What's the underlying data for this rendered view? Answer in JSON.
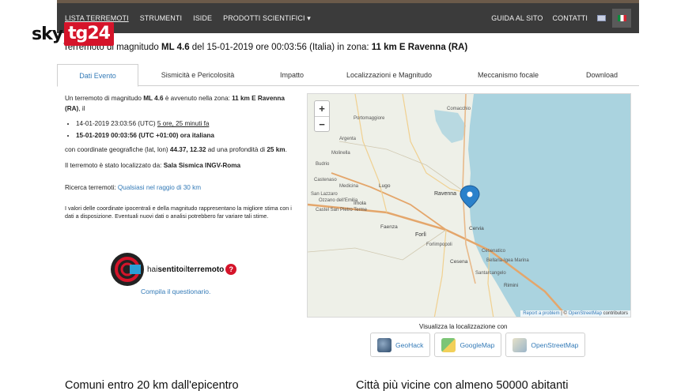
{
  "nav": {
    "items": [
      "LISTA TERREMOTI",
      "STRUMENTI",
      "ISIDE",
      "PRODOTTI SCIENTIFICI ▾"
    ],
    "right": [
      "GUIDA AL SITO",
      "CONTATTI"
    ]
  },
  "logo": {
    "sky": "sky",
    "tg": "tg24"
  },
  "headline": {
    "pre": "Terremoto di magnitudo ",
    "mag": "ML 4.6",
    "mid": " del 15-01-2019 ore 00:03:56 (Italia) in zona: ",
    "zone": "11 km E Ravenna (RA)"
  },
  "tabs": [
    "Dati Evento",
    "Sismicità e Pericolosità",
    "Impatto",
    "Localizzazioni e Magnitudo",
    "Meccanismo focale",
    "Download"
  ],
  "event": {
    "intro_pre": "Un terremoto di magnitudo ",
    "intro_mag": "ML 4.6",
    "intro_mid": " è avvenuto nella zona: ",
    "intro_zone": "11 km E Ravenna (RA)",
    "intro_post": ", il",
    "utc_time": "14-01-2019 23:03:56 (UTC) ",
    "utc_ago": "5 ore, 25 minuti fa",
    "local_time": "15-01-2019 00:03:56 (UTC +01:00) ora italiana",
    "coord_pre": "con coordinate geografiche (lat, lon) ",
    "coord_vals": "44.37, 12.32",
    "coord_mid": " ad una profondità di ",
    "depth": "25 km",
    "coord_post": ".",
    "loc_pre": "Il terremoto è stato localizzato da: ",
    "loc_by": "Sala Sismica INGV-Roma",
    "search_pre": "Ricerca terremoti: ",
    "search_link": "Qualsiasi nel raggio di 30 km",
    "note": "I valori delle coordinate ipocentrali e della magnitudo rappresentano la migliore stima con i dati a disposizione. Eventuali nuovi dati o analisi potrebbero far variare tali stime."
  },
  "hsit": {
    "text_a": "hai",
    "text_b": "sentito",
    "text_c": "il",
    "text_d": "terremoto",
    "q": "?",
    "compila": "Compila il questionario."
  },
  "map": {
    "zoom_in": "+",
    "zoom_out": "−",
    "attrib_link": "Report a problem",
    "attrib_sep": " | © ",
    "attrib_osm": "OpenStreetMap",
    "attrib_post": " contributors",
    "places": [
      "Portomaggiore",
      "Argenta",
      "Budrio",
      "Molinella",
      "Imola",
      "Lugo",
      "Ravenna",
      "Castel San Pietro Terme",
      "Faenza",
      "Forlì",
      "Forlimpopoli",
      "Cesena",
      "Cervia",
      "Cesenatico",
      "Bellaria-Igea Marina",
      "Santarcangelo",
      "Rimini",
      "Ozzano dell'Emilia",
      "San Lazzaro",
      "Castenaso",
      "Medicina",
      "Comacchio"
    ],
    "colors": {
      "sea": "#aad3df",
      "land": "#eef0e8",
      "road": "#e4a66b",
      "marker": "#2a81cb"
    }
  },
  "viz": {
    "label": "Visualizza la localizzazione con",
    "buttons": [
      "GeoHack",
      "GoogleMap",
      "OpenStreetMap"
    ]
  },
  "bottom": {
    "left": "Comuni entro 20 km dall'epicentro",
    "right": "Città più vicine con almeno 50000 abitanti"
  }
}
